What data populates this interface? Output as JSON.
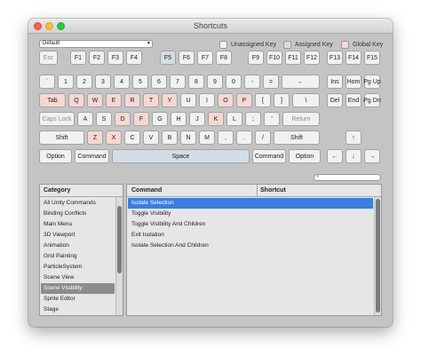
{
  "window": {
    "title": "Shortcuts"
  },
  "profile": {
    "selected": "Default"
  },
  "legend": {
    "unassigned": "Unassigned Key",
    "assigned": "Assigned Key",
    "global": "Global Key"
  },
  "colors": {
    "unassigned": "#f1f1f1",
    "assigned": "#d3dde5",
    "global": "#f5d8d2",
    "selection": "#3c7de0"
  },
  "keys": {
    "esc": "Esc",
    "f1": "F1",
    "f2": "F2",
    "f3": "F3",
    "f4": "F4",
    "f5": "F5",
    "f6": "F6",
    "f7": "F7",
    "f8": "F8",
    "f9": "F9",
    "f10": "F10",
    "f11": "F11",
    "f12": "F12",
    "f13": "F13",
    "f14": "F14",
    "f15": "F15",
    "backquote": "`",
    "d1": "1",
    "d2": "2",
    "d3": "3",
    "d4": "4",
    "d5": "5",
    "d6": "6",
    "d7": "7",
    "d8": "8",
    "d9": "9",
    "d0": "0",
    "minus": "-",
    "equals": "=",
    "backspace": "←",
    "ins": "Ins",
    "home": "Hom",
    "pgup": "Pg Up",
    "tab": "Tab",
    "q": "Q",
    "w": "W",
    "e": "E",
    "r": "R",
    "t": "T",
    "y": "Y",
    "u": "U",
    "i": "I",
    "o": "O",
    "p": "P",
    "lbracket": "[",
    "rbracket": "]",
    "backslash": "\\",
    "del": "Del",
    "end": "End",
    "pgdn": "Pg Dn",
    "capslock": "Caps Lock",
    "a": "A",
    "s": "S",
    "d": "D",
    "f": "F",
    "g": "G",
    "h": "H",
    "j": "J",
    "k": "K",
    "l": "L",
    "semicolon": ";",
    "quote": "'",
    "return": "Return",
    "lshift": "Shift",
    "z": "Z",
    "x": "X",
    "c": "C",
    "v": "V",
    "b": "B",
    "n": "N",
    "m": "M",
    "comma": ",",
    "period": ".",
    "slash": "/",
    "rshift": "Shift",
    "up": "↑",
    "loption": "Option",
    "lcommand": "Command",
    "space": "Space",
    "rcommand": "Command",
    "roption": "Option",
    "left": "←",
    "down": "↓",
    "right": "→"
  },
  "categories": {
    "header": "Category",
    "items": [
      "All Unity Commands",
      "Binding Conflicts",
      "Main Menu",
      "3D Viewport",
      "Animation",
      "Grid Painting",
      "ParticleSystem",
      "Scene View",
      "Scene Visibility",
      "Sprite Editor",
      "Stage"
    ],
    "selected": "Scene Visibility"
  },
  "commands": {
    "header_command": "Command",
    "header_shortcut": "Shortcut",
    "items": [
      "Isolate Selection",
      "Toggle Visibility",
      "Toggle Visibility And Children",
      "Exit Isolation",
      "Isolate Selection And Children"
    ],
    "selected": "Isolate Selection"
  }
}
